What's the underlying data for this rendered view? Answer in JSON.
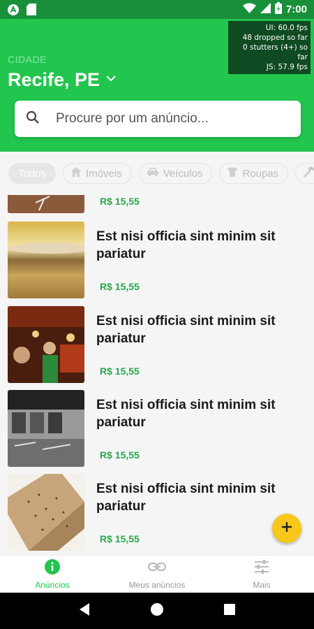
{
  "status_bar": {
    "time": "7:00"
  },
  "perf_monitor": {
    "lines": [
      "UI: 60.0 fps",
      "48 dropped so far",
      "0 stutters (4+) so far",
      "JS: 57.9 fps"
    ]
  },
  "header": {
    "city_label": "CIDADE",
    "city_name": "Recife, PE",
    "search_placeholder": "Procure por um anúncio..."
  },
  "categories": [
    {
      "label": "Todos",
      "icon": "none",
      "active": true
    },
    {
      "label": "Imóveis",
      "icon": "house-icon",
      "active": false
    },
    {
      "label": "Veículos",
      "icon": "car-icon",
      "active": false
    },
    {
      "label": "Roupas",
      "icon": "shirt-icon",
      "active": false
    },
    {
      "label": "",
      "icon": "hammer-icon",
      "active": false
    }
  ],
  "listings": [
    {
      "title": "",
      "price": "R$ 15,55"
    },
    {
      "title": "Est nisi officia sint minim sit pariatur",
      "price": "R$ 15,55"
    },
    {
      "title": "Est nisi officia sint minim sit pariatur",
      "price": "R$ 15,55"
    },
    {
      "title": "Est nisi officia sint minim sit pariatur",
      "price": "R$ 15,55"
    },
    {
      "title": "Est nisi officia sint minim sit pariatur",
      "price": "R$ 15,55"
    }
  ],
  "bottom_nav": [
    {
      "label": "Anúncios",
      "icon": "info-icon",
      "active": true
    },
    {
      "label": "Meus anúncios",
      "icon": "link-icon",
      "active": false
    },
    {
      "label": "Mais",
      "icon": "sliders-icon",
      "active": false
    }
  ],
  "colors": {
    "primary_green": "#22c54e",
    "status_bar_green": "#1a8f3a",
    "price_green": "#29a84c",
    "fab_yellow": "#f7c71a"
  }
}
